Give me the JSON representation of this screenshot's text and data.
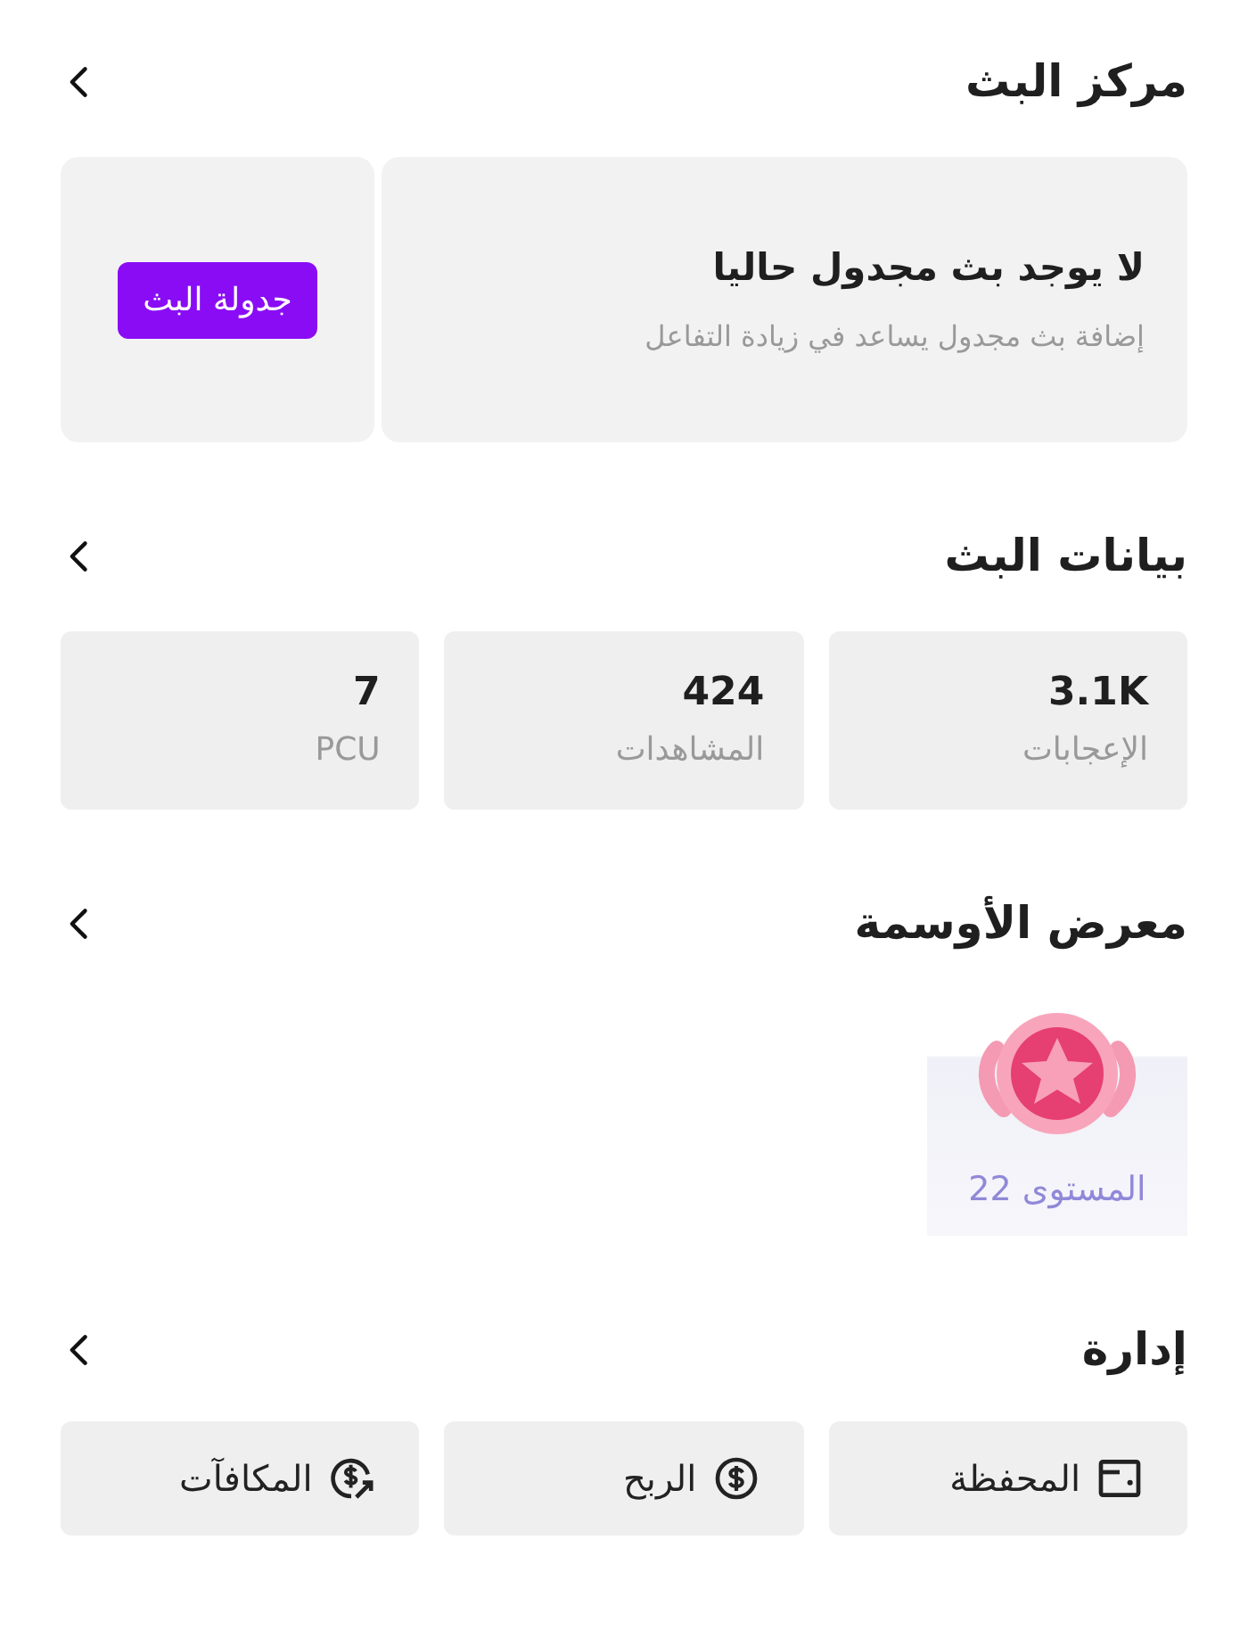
{
  "sections": [
    {
      "kind": "schedule",
      "title": "مركز البث",
      "card": {
        "title": "لا يوجد بث مجدول حاليا",
        "subtitle": "إضافة بث مجدول يساعد في زيادة التفاعل",
        "button": "جدولة البث"
      }
    },
    {
      "kind": "stats",
      "title": "بيانات البث",
      "stats": [
        {
          "value": "3.1K",
          "label": "الإعجابات"
        },
        {
          "value": "424",
          "label": "المشاهدات"
        },
        {
          "value": "7",
          "label": "PCU"
        }
      ]
    },
    {
      "kind": "badges",
      "title": "معرض الأوسمة",
      "badges": [
        {
          "label": "المستوى 22"
        }
      ]
    },
    {
      "kind": "manage",
      "title": "إدارة",
      "buttons": [
        {
          "kind": "wallet",
          "label": "المحفظة"
        },
        {
          "kind": "earnings",
          "label": "الربح"
        },
        {
          "kind": "rewards",
          "label": "المكافآت"
        }
      ]
    }
  ]
}
